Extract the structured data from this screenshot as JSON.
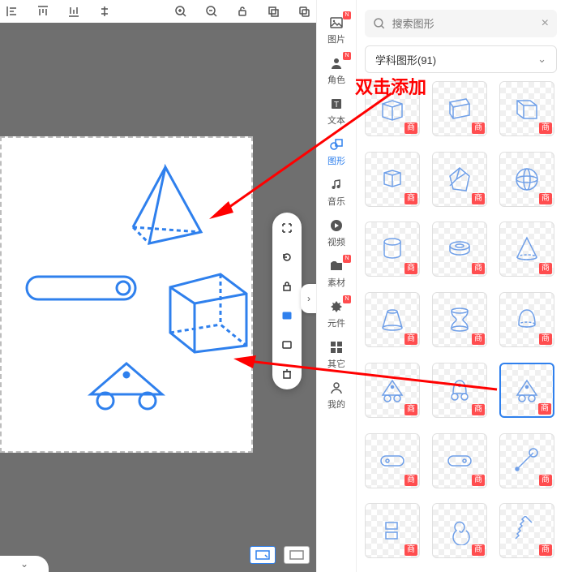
{
  "hint_text": "双击添加",
  "search": {
    "placeholder": "搜索图形"
  },
  "dropdown": {
    "label": "学科图形(91)"
  },
  "rail": [
    {
      "key": "image",
      "label": "图片",
      "new": true
    },
    {
      "key": "role",
      "label": "角色",
      "new": true
    },
    {
      "key": "text",
      "label": "文本",
      "new": false
    },
    {
      "key": "shape",
      "label": "图形",
      "new": false,
      "active": true
    },
    {
      "key": "music",
      "label": "音乐",
      "new": false
    },
    {
      "key": "video",
      "label": "视频",
      "new": false
    },
    {
      "key": "asset",
      "label": "素材",
      "new": true
    },
    {
      "key": "widget",
      "label": "元件",
      "new": true
    },
    {
      "key": "other",
      "label": "其它",
      "new": false
    },
    {
      "key": "mine",
      "label": "我的",
      "new": false
    }
  ],
  "tile_tag": "商",
  "badge_new": "N",
  "tiles": [
    {
      "shape": "cube1",
      "tag": true
    },
    {
      "shape": "cube-diag",
      "tag": true
    },
    {
      "shape": "cube-open",
      "tag": true
    },
    {
      "shape": "cube-small",
      "tag": true
    },
    {
      "shape": "rhomb",
      "tag": true
    },
    {
      "shape": "sphere",
      "tag": true
    },
    {
      "shape": "cylinder",
      "tag": true
    },
    {
      "shape": "ring",
      "tag": true
    },
    {
      "shape": "cone",
      "tag": true
    },
    {
      "shape": "frustum",
      "tag": true
    },
    {
      "shape": "hourglass",
      "tag": true
    },
    {
      "shape": "bell",
      "tag": true
    },
    {
      "shape": "cart-tri",
      "tag": true
    },
    {
      "shape": "cart-bell",
      "tag": true
    },
    {
      "shape": "cart-tri2",
      "tag": true,
      "selected": true
    },
    {
      "shape": "pill",
      "tag": true
    },
    {
      "shape": "pill2",
      "tag": true
    },
    {
      "shape": "lever",
      "tag": true
    },
    {
      "shape": "stack",
      "tag": true
    },
    {
      "shape": "spiral",
      "tag": true
    },
    {
      "shape": "spring",
      "tag": true
    }
  ]
}
